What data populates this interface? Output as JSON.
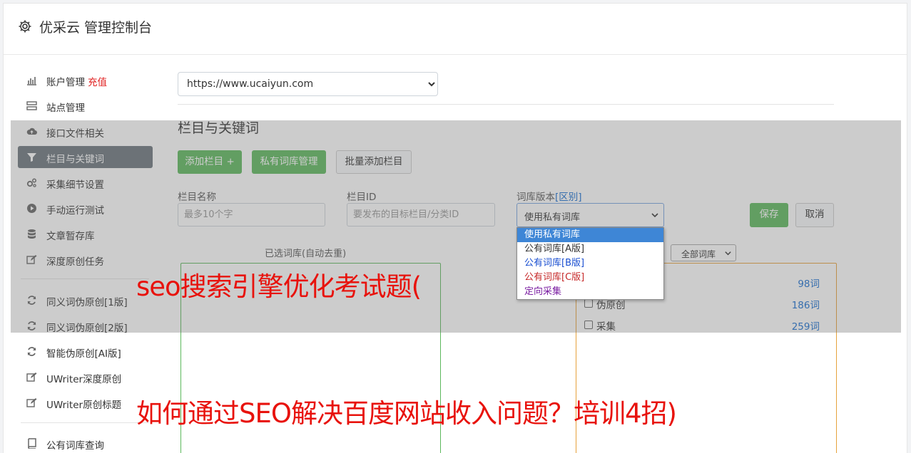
{
  "app": {
    "title": "优采云 管理控制台"
  },
  "sidebar": {
    "items": [
      {
        "label": "账户管理",
        "badge": "充值",
        "icon": "bar-chart-icon"
      },
      {
        "label": "站点管理",
        "icon": "server-icon"
      },
      {
        "label": "接口文件相关",
        "icon": "cloud-upload-icon"
      },
      {
        "label": "栏目与关键词",
        "icon": "filter-icon",
        "active": true
      },
      {
        "label": "采集细节设置",
        "icon": "cogs-icon"
      },
      {
        "label": "手动运行测试",
        "icon": "play-circle-icon"
      },
      {
        "label": "文章暂存库",
        "icon": "database-icon"
      },
      {
        "label": "深度原创任务",
        "icon": "edit-icon"
      },
      {
        "label": "同义词伪原创[1版]",
        "icon": "refresh-icon"
      },
      {
        "label": "同义词伪原创[2版]",
        "icon": "refresh-icon"
      },
      {
        "label": "智能伪原创[AI版]",
        "icon": "refresh-icon"
      },
      {
        "label": "UWriter深度原创",
        "icon": "edit-icon"
      },
      {
        "label": "UWriter原创标题",
        "icon": "edit-icon"
      },
      {
        "label": "公有词库查询",
        "icon": "book-icon"
      }
    ]
  },
  "main": {
    "site_select": "https://www.ucaiyun.com",
    "section_title": "栏目与关键词",
    "buttons": {
      "add_column": "添加栏目 +",
      "private_lib": "私有词库管理",
      "batch_add": "批量添加栏目",
      "save": "保存",
      "cancel": "取消"
    },
    "fields": {
      "column_name_label": "栏目名称",
      "column_name_placeholder": "最多10个字",
      "column_id_label": "栏目ID",
      "column_id_placeholder": "要发布的目标栏目/分类ID",
      "version_label": "词库版本",
      "version_link": "[区别]",
      "version_value": "使用私有词库"
    },
    "version_options": [
      {
        "label": "使用私有词库",
        "color": "#ffffff",
        "selected": true
      },
      {
        "label": "公有词库[A版]",
        "color": "#333333"
      },
      {
        "label": "公有词库[B版]",
        "color": "#1a4fd1"
      },
      {
        "label": "公有词库[C版]",
        "color": "#c62828"
      },
      {
        "label": "定向采集",
        "color": "#7b1fa2"
      }
    ],
    "selected_lib_label": "已选词库(自动去重)",
    "lib_filter": "全部词库",
    "libraries": [
      {
        "name": "",
        "count": "98词"
      },
      {
        "name": "伪原创",
        "count": "186词"
      },
      {
        "name": "采集",
        "count": "259词"
      }
    ]
  },
  "captions": {
    "line1": "seo搜索引擎优化考试题(",
    "line2": "如何通过SEO解决百度网站收入问题？培训4招)"
  },
  "colors": {
    "accent_green": "#5cb85c",
    "active_nav": "#6c757d",
    "caption_red": "#e8120c",
    "link_blue": "#1a6fd1"
  }
}
